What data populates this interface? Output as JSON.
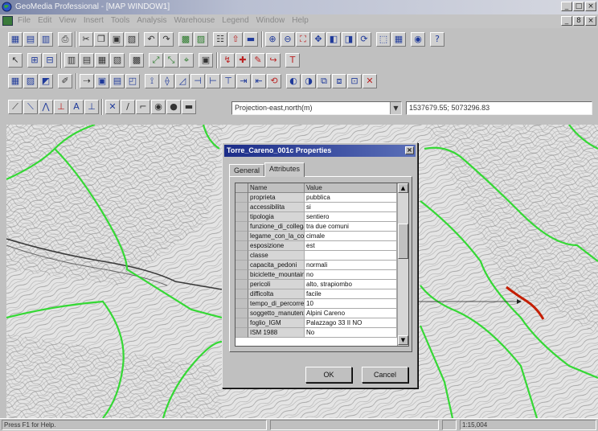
{
  "window": {
    "title": "GeoMedia Professional - [MAP WINDOW1]",
    "controls": [
      "_",
      "□",
      "×"
    ]
  },
  "menubar": {
    "items": [
      "File",
      "Edit",
      "View",
      "Insert",
      "Tools",
      "Analysis",
      "Warehouse",
      "Legend",
      "Window",
      "Help"
    ],
    "mdi_controls": [
      "_",
      "8",
      "×"
    ]
  },
  "coordinate_bar": {
    "projection_label": "Projection-east,north(m)",
    "coordinates": "1537679.55; 5073296.83"
  },
  "dialog": {
    "title": "Torre_Careno_001c Properties",
    "close": "×",
    "tabs": [
      "General",
      "Attributes"
    ],
    "active_tab": "Attributes",
    "grid": {
      "headers": [
        "Name",
        "Value"
      ],
      "rows": [
        {
          "name": "proprieta",
          "value": "pubblica"
        },
        {
          "name": "accessibilita",
          "value": "si"
        },
        {
          "name": "tipologia",
          "value": "sentiero"
        },
        {
          "name": "funzione_di_collegar",
          "value": "tra due comuni"
        },
        {
          "name": "legame_con_la_cons",
          "value": "cimale"
        },
        {
          "name": "esposizione",
          "value": "est"
        },
        {
          "name": "classe",
          "value": ""
        },
        {
          "name": "capacita_pedoni",
          "value": "normali"
        },
        {
          "name": "biciclette_mountainb",
          "value": "no"
        },
        {
          "name": "pericoli",
          "value": "alto, strapiombo"
        },
        {
          "name": "difficolta",
          "value": "facile"
        },
        {
          "name": "tempo_di_percorren",
          "value": "10"
        },
        {
          "name": "soggetto_manutenzi",
          "value": "Alpini Careno"
        },
        {
          "name": "foglio_IGM",
          "value": "Palazzago 33 II NO"
        },
        {
          "name": "ISM 1988",
          "value": "No"
        }
      ]
    },
    "buttons": {
      "ok": "OK",
      "cancel": "Cancel"
    }
  },
  "statusbar": {
    "help_text": "Press F1 for Help.",
    "scale": "1:15,004"
  },
  "colors": {
    "map_background": "#e2e2e2",
    "boundary_lines": "#33dd33",
    "selected_path": "#cc2200",
    "dialog_title": "#1b2c88"
  }
}
